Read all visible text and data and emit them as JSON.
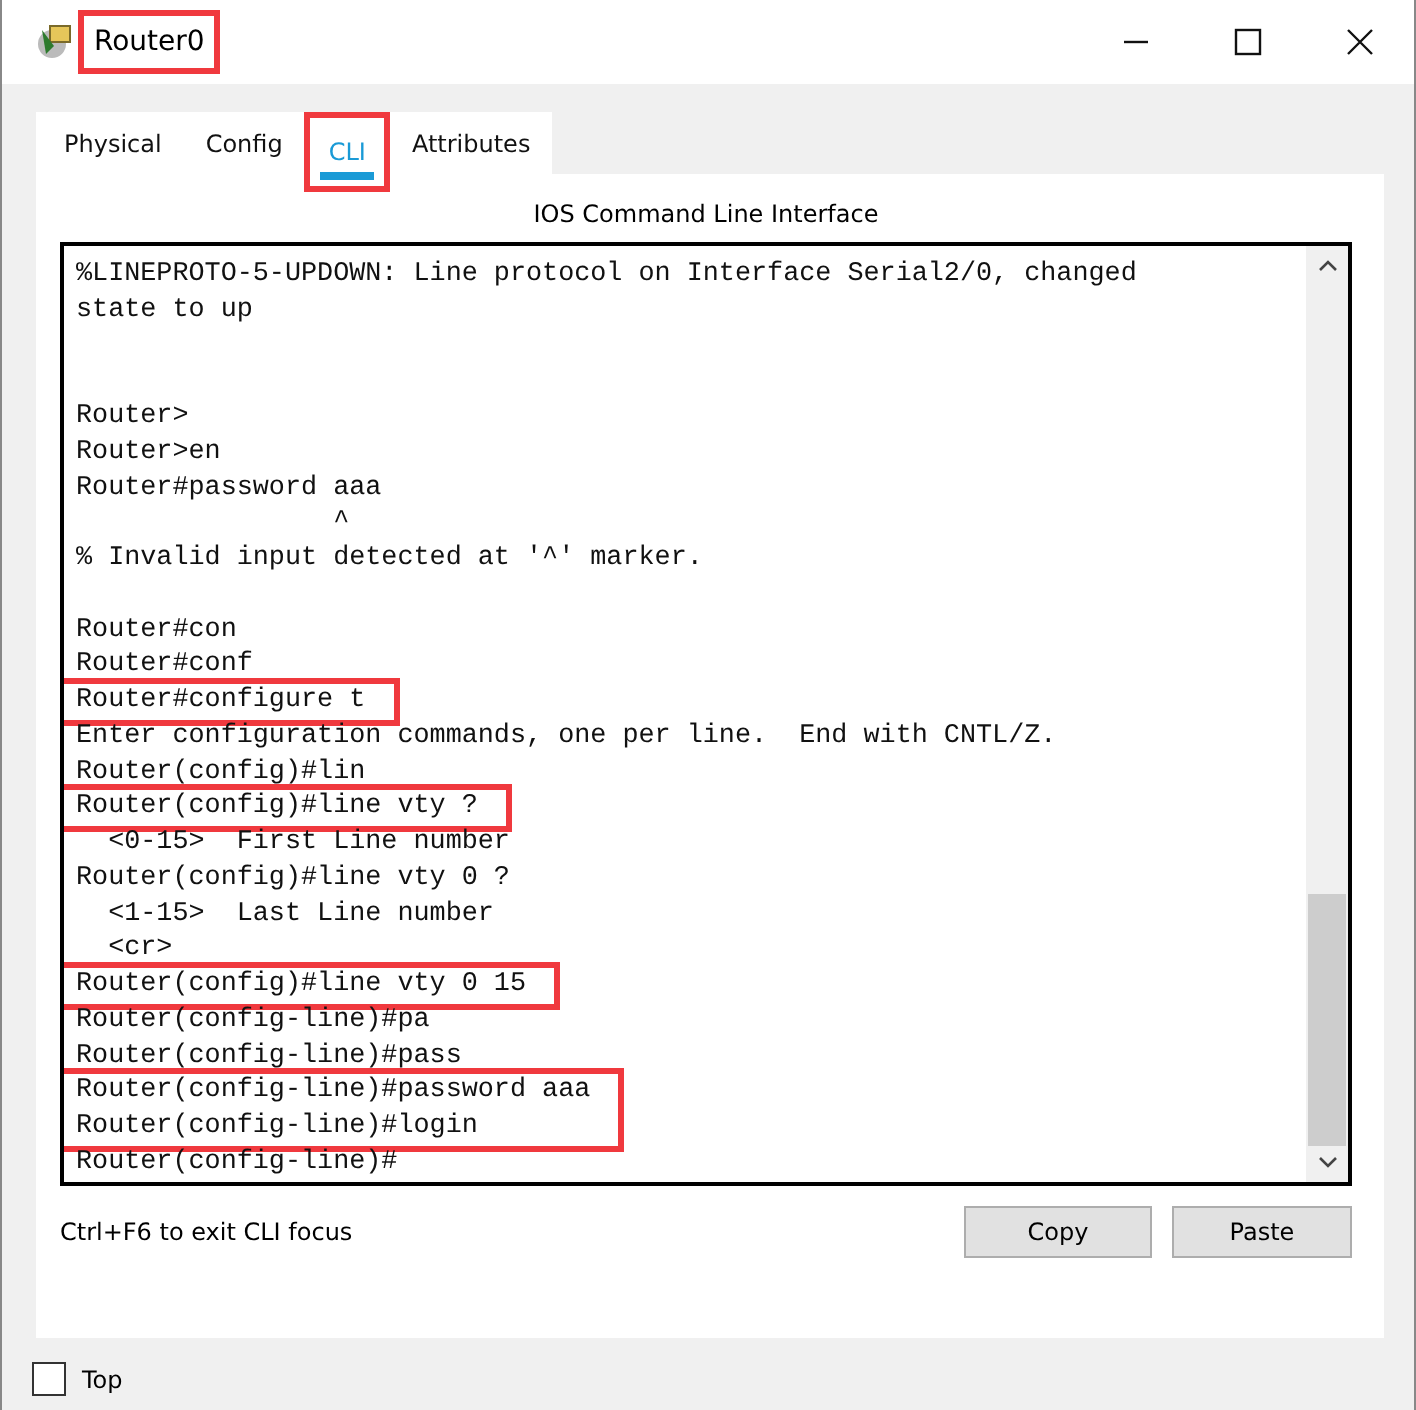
{
  "window": {
    "title": "Router0",
    "title_highlighted": true
  },
  "tabs": [
    {
      "label": "Physical",
      "selected": false,
      "highlighted": false
    },
    {
      "label": "Config",
      "selected": false,
      "highlighted": false
    },
    {
      "label": "CLI",
      "selected": true,
      "highlighted": true
    },
    {
      "label": "Attributes",
      "selected": false,
      "highlighted": false
    }
  ],
  "panel_title": "IOS Command Line Interface",
  "terminal": [
    {
      "kind": "text",
      "lines": [
        "%LINEPROTO-5-UPDOWN: Line protocol on Interface Serial2/0, changed",
        "state to up"
      ]
    },
    {
      "kind": "blank"
    },
    {
      "kind": "blank"
    },
    {
      "kind": "text",
      "lines": [
        "Router>",
        "Router>en",
        "Router#password aaa",
        "                ^",
        "% Invalid input detected at '^' marker."
      ]
    },
    {
      "kind": "blank"
    },
    {
      "kind": "text",
      "lines": [
        "Router#con",
        "Router#conf"
      ]
    },
    {
      "kind": "highlight",
      "lines": [
        "Router#configure t"
      ]
    },
    {
      "kind": "text",
      "lines": [
        "Enter configuration commands, one per line.  End with CNTL/Z.",
        "Router(config)#lin"
      ]
    },
    {
      "kind": "highlight",
      "lines": [
        "Router(config)#line vty ?"
      ]
    },
    {
      "kind": "text",
      "lines": [
        "  <0-15>  First Line number",
        "Router(config)#line vty 0 ?",
        "  <1-15>  Last Line number",
        "  <cr>"
      ]
    },
    {
      "kind": "highlight",
      "lines": [
        "Router(config)#line vty 0 15"
      ]
    },
    {
      "kind": "text",
      "lines": [
        "Router(config-line)#pa",
        "Router(config-line)#pass"
      ]
    },
    {
      "kind": "highlight",
      "lines": [
        "Router(config-line)#password aaa",
        "Router(config-line)#login"
      ]
    },
    {
      "kind": "text",
      "lines": [
        "Router(config-line)#"
      ]
    }
  ],
  "hint": "Ctrl+F6 to exit CLI focus",
  "buttons": [
    "Copy",
    "Paste"
  ],
  "top_checkbox": {
    "label": "Top",
    "checked": false
  }
}
